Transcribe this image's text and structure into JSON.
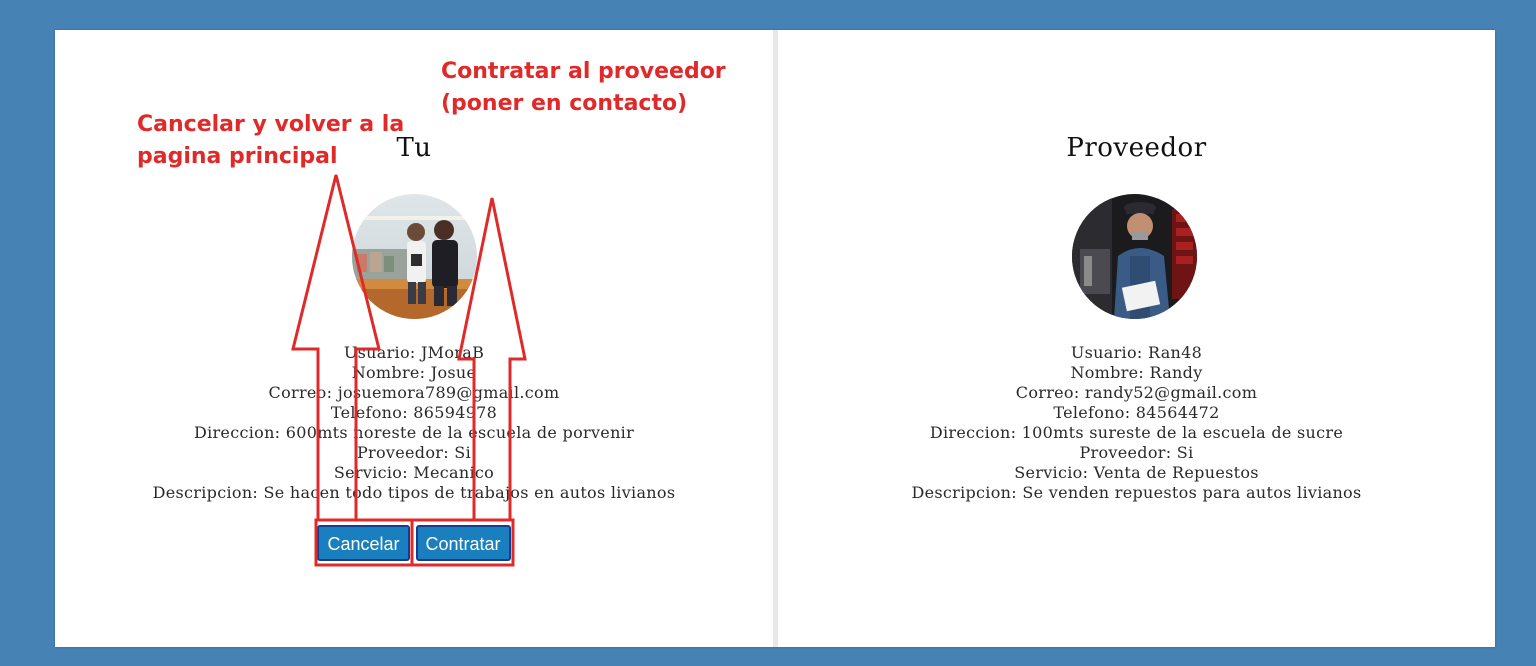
{
  "colors": {
    "background": "#4682b4",
    "button": "#1a7fbf",
    "annotation": "#e02a2a"
  },
  "user_panel": {
    "title": "Tu",
    "avatar": "user-photo",
    "fields": [
      "Usuario: JMoraB",
      "Nombre: Josue",
      "Correo: josuemora789@gmail.com",
      "Telefono: 86594978",
      "Direccion: 600mts noreste de la escuela de porvenir",
      "Proveedor: Si",
      "Servicio: Mecanico",
      "Descripcion: Se hacen todo tipos de trabajos en autos livianos"
    ],
    "cancel_label": "Cancelar",
    "contract_label": "Contratar"
  },
  "provider_panel": {
    "title": "Proveedor",
    "avatar": "provider-photo",
    "fields": [
      "Usuario: Ran48",
      "Nombre: Randy",
      "Correo: randy52@gmail.com",
      "Telefono: 84564472",
      "Direccion: 100mts sureste de la escuela de sucre",
      "Proveedor: Si",
      "Servicio: Venta de Repuestos",
      "Descripcion: Se venden repuestos para autos livianos"
    ]
  },
  "annotations": {
    "cancel": {
      "line1": "Cancelar y volver a la",
      "line2": "pagina principal"
    },
    "contract": {
      "line1": "Contratar al proveedor",
      "line2": "(poner en contacto)"
    }
  }
}
